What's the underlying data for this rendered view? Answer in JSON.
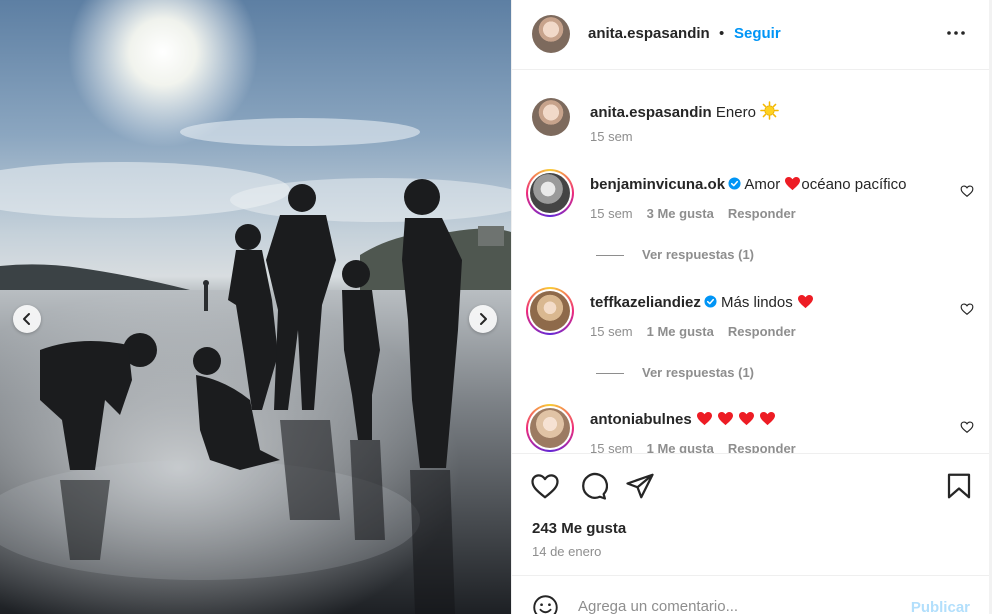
{
  "post": {
    "author": "anita.espasandin",
    "follow_label": "Seguir",
    "separator": "•"
  },
  "caption": {
    "username": "anita.espasandin",
    "text": "Enero",
    "emoji": "sun",
    "time": "15 sem"
  },
  "comments": [
    {
      "username": "benjaminvicuna.ok",
      "verified": true,
      "text_before": "Amor",
      "text_after": "océano pacífico",
      "time": "15 sem",
      "likes": "3 Me gusta",
      "reply_label": "Responder",
      "view_replies": "Ver respuestas (1)"
    },
    {
      "username": "teffkazeliandiez",
      "verified": true,
      "text_before": "Más lindos",
      "time": "15 sem",
      "likes": "1 Me gusta",
      "reply_label": "Responder",
      "view_replies": "Ver respuestas (1)"
    },
    {
      "username": "antoniabulnes",
      "verified": false,
      "hearts": 4,
      "time": "15 sem",
      "likes": "1 Me gusta",
      "reply_label": "Responder"
    }
  ],
  "stats": {
    "likes": "243 Me gusta",
    "date": "14 de enero"
  },
  "add_comment": {
    "placeholder": "Agrega un comentario...",
    "publish_label": "Publicar"
  },
  "icons": [
    "chevron-left-icon",
    "chevron-right-icon",
    "more-icon",
    "heart-icon",
    "comment-icon",
    "share-icon",
    "bookmark-icon",
    "emoji-icon",
    "verified-badge-icon"
  ],
  "colors": {
    "accent": "#0095f6",
    "verified": "#0095f6",
    "heart": "#ed1c24",
    "muted": "#8e8e8e",
    "publish_disabled": "#b2dffc"
  }
}
